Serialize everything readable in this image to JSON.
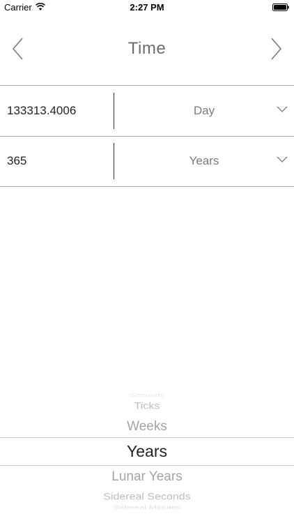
{
  "status_bar": {
    "carrier": "Carrier",
    "time": "2:27 PM",
    "wifi_icon": "wifi-icon",
    "battery_icon": "battery-full-icon"
  },
  "nav": {
    "title": "Time",
    "prev_icon": "chevron-left-icon",
    "next_icon": "chevron-right-icon"
  },
  "conversions": [
    {
      "value": "133313.4006",
      "unit": "Day"
    },
    {
      "value": "365",
      "unit": "Years"
    }
  ],
  "picker": {
    "items": [
      "Seconds",
      "Ticks",
      "Weeks",
      "Years",
      "Lunar Years",
      "Sidereal Seconds",
      "Sidereal Minutes"
    ],
    "selected": "Years"
  },
  "colors": {
    "divider": "#a8a8a8",
    "title": "#6d6d6d",
    "unit_text": "#7a7a7a",
    "picker_selected": "#222222",
    "picker_dim": "#a4a4a4"
  }
}
